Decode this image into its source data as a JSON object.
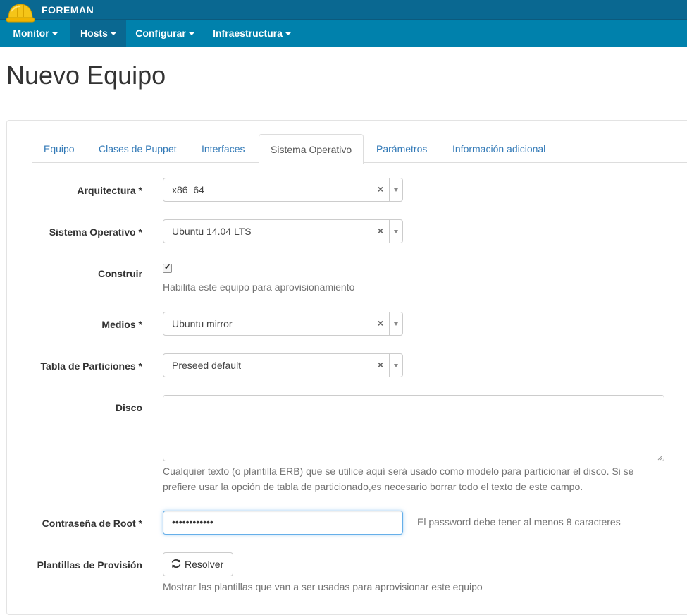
{
  "brand": {
    "name": "FOREMAN"
  },
  "nav": {
    "items": [
      {
        "label": "Monitor"
      },
      {
        "label": "Hosts"
      },
      {
        "label": "Configurar"
      },
      {
        "label": "Infraestructura"
      }
    ]
  },
  "page": {
    "title": "Nuevo Equipo"
  },
  "tabs": [
    {
      "label": "Equipo"
    },
    {
      "label": "Clases de Puppet"
    },
    {
      "label": "Interfaces"
    },
    {
      "label": "Sistema Operativo"
    },
    {
      "label": "Parámetros"
    },
    {
      "label": "Información adicional"
    }
  ],
  "form": {
    "architecture": {
      "label": "Arquitectura *",
      "value": "x86_64",
      "clear": "×"
    },
    "os": {
      "label": "Sistema Operativo *",
      "value": "Ubuntu 14.04 LTS",
      "clear": "×"
    },
    "build": {
      "label": "Construir",
      "checked": true,
      "help": "Habilita este equipo para aprovisionamiento"
    },
    "media": {
      "label": "Medios *",
      "value": "Ubuntu mirror",
      "clear": "×"
    },
    "ptable": {
      "label": "Tabla de Particiones *",
      "value": "Preseed default",
      "clear": "×"
    },
    "disk": {
      "label": "Disco",
      "value": "",
      "help_line1": "Cualquier texto (o plantilla ERB) que se utilice aquí será usado como modelo para particionar el disco. Si se",
      "help_line2": "prefiere usar la opción de tabla de particionado,es necesario borrar todo el texto de este campo."
    },
    "root_pass": {
      "label": "Contraseña de Root *",
      "value": "••••••••••••",
      "help": "El password debe tener al menos 8 caracteres"
    },
    "templates": {
      "label": "Plantillas de Provisión",
      "button": "Resolver",
      "help": "Mostrar las plantillas que van a ser usadas para aprovisionar este equipo"
    }
  },
  "colors": {
    "brand_bar": "#0a6891",
    "nav_bar": "#0081ac",
    "link": "#337ab7",
    "helmet": "#f5c518"
  },
  "icons": {
    "logo": "helmet-icon",
    "button": "refresh-icon"
  }
}
